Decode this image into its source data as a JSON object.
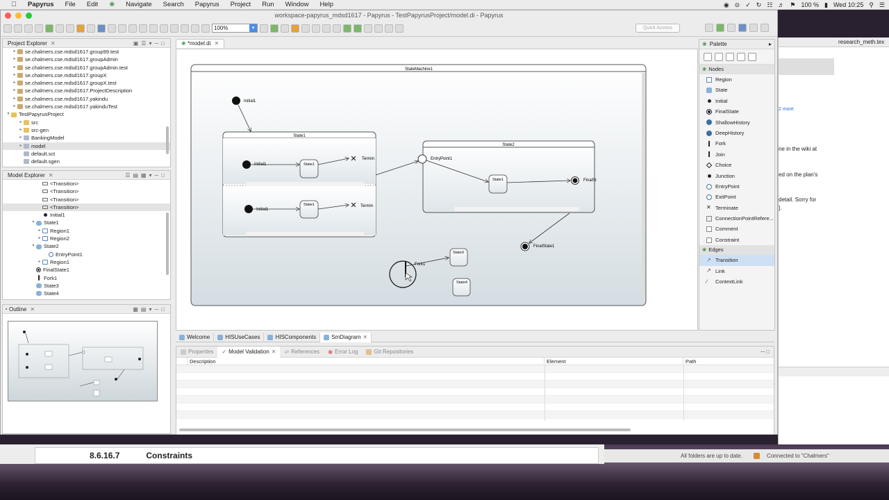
{
  "menubar": {
    "app": "Papyrus",
    "items": [
      "File",
      "Edit",
      "Navigate",
      "Search",
      "Papyrus",
      "Project",
      "Run",
      "Window",
      "Help"
    ],
    "battery": "100 %",
    "clock": "Wed 10:25"
  },
  "window": {
    "title": "workspace-papyrus_mdsd1617 - Papyrus - TestPapyrusProject/model.di - Papyrus"
  },
  "toolbar": {
    "zoom": "100%",
    "quick_access": "Quick Access"
  },
  "project_explorer": {
    "title": "Project Explorer",
    "items": [
      {
        "label": "se.chalmers.cse.mdsd1617.group99.test",
        "indent": 1
      },
      {
        "label": "se.chalmers.cse.mdsd1617.groupAdmin",
        "indent": 1
      },
      {
        "label": "se.chalmers.cse.mdsd1617.groupAdmin.test",
        "indent": 1
      },
      {
        "label": "se.chalmers.cse.mdsd1617.groupX",
        "indent": 1
      },
      {
        "label": "se.chalmers.cse.mdsd1617.groupX.test",
        "indent": 1
      },
      {
        "label": "se.chalmers.cse.mdsd1617.ProjectDescription",
        "indent": 1
      },
      {
        "label": "se.chalmers.cse.mdsd1617.yakindu",
        "indent": 1
      },
      {
        "label": "se.chalmers.cse.mdsd1617.yakinduTest",
        "indent": 1
      },
      {
        "label": "TestPapyrusProject",
        "indent": 0
      },
      {
        "label": "src",
        "indent": 2
      },
      {
        "label": "src-gen",
        "indent": 2
      },
      {
        "label": "BankingModel",
        "indent": 2
      },
      {
        "label": "model",
        "indent": 2
      },
      {
        "label": "default.sct",
        "indent": 2
      },
      {
        "label": "default.sgen",
        "indent": 2
      }
    ]
  },
  "model_explorer": {
    "title": "Model Explorer",
    "items": [
      {
        "label": "<Transition>",
        "indent": 5,
        "icon": "tr"
      },
      {
        "label": "<Transition>",
        "indent": 5,
        "icon": "tr"
      },
      {
        "label": "<Transition>",
        "indent": 5,
        "icon": "tr"
      },
      {
        "label": "<Transition>",
        "indent": 5,
        "icon": "tr"
      },
      {
        "label": "Initial1",
        "indent": 5,
        "icon": "dot"
      },
      {
        "label": "State1",
        "indent": 4,
        "icon": "st"
      },
      {
        "label": "Region1",
        "indent": 5,
        "icon": "rg"
      },
      {
        "label": "Region2",
        "indent": 5,
        "icon": "rg"
      },
      {
        "label": "State2",
        "indent": 4,
        "icon": "st"
      },
      {
        "label": "EntryPoint1",
        "indent": 6,
        "icon": "ep"
      },
      {
        "label": "Region1",
        "indent": 5,
        "icon": "rg"
      },
      {
        "label": "FinalState1",
        "indent": 4,
        "icon": "fin"
      },
      {
        "label": "Fork1",
        "indent": 4,
        "icon": "fork"
      },
      {
        "label": "State3",
        "indent": 4,
        "icon": "st"
      },
      {
        "label": "State4",
        "indent": 4,
        "icon": "st"
      }
    ]
  },
  "outline": {
    "title": "Outline"
  },
  "editor_tab": "*model.di",
  "diagram": {
    "machine": "StateMachine1",
    "initial": "Initial1",
    "state1": "State1",
    "state1_r1_initial": "Initial1",
    "state1_r1_state": "State1",
    "state1_r1_term": "Termin",
    "state1_r2_initial": "Initial1",
    "state1_r2_state": "State1",
    "state1_r2_term": "Termin",
    "state2": "State2",
    "entry": "EntryPoint1",
    "state2_inner": "State1",
    "state2_final": "FinalSt",
    "final": "FinalState1",
    "fork": "Fork1",
    "state3": "State3",
    "state4": "State4"
  },
  "palette": {
    "title": "Palette",
    "nodes_label": "Nodes",
    "nodes": [
      "Region",
      "State",
      "Initial",
      "FinalState",
      "ShallowHistory",
      "DeepHistory",
      "Fork",
      "Join",
      "Choice",
      "Junction",
      "EntryPoint",
      "ExitPoint",
      "Terminate",
      "ConnectionPointRefere...",
      "Comment",
      "Constraint"
    ],
    "edges_label": "Edges",
    "edges": [
      "Transition",
      "Link",
      "ContextLink"
    ]
  },
  "diagram_tabs": [
    "Welcome",
    "HISUseCases",
    "HISComponents",
    "SmDiagram"
  ],
  "bottom_tabs": [
    "Properties",
    "Model Validation",
    "References",
    "Error Log",
    "Git Repositories"
  ],
  "validation_columns": [
    "Description",
    "Element",
    "Path"
  ],
  "statusbar": {
    "folders": "All folders are up to date.",
    "connected": "Connected to \"Chalmers\""
  },
  "background": {
    "doc_number": "8.6.16.7",
    "doc_heading": "Constraints",
    "tab": "research_meth.tex",
    "snippets": [
      "ne in the wiki at",
      "ed on the plan's",
      "detail. Sorry for",
      "]."
    ],
    "link": "2 more"
  }
}
